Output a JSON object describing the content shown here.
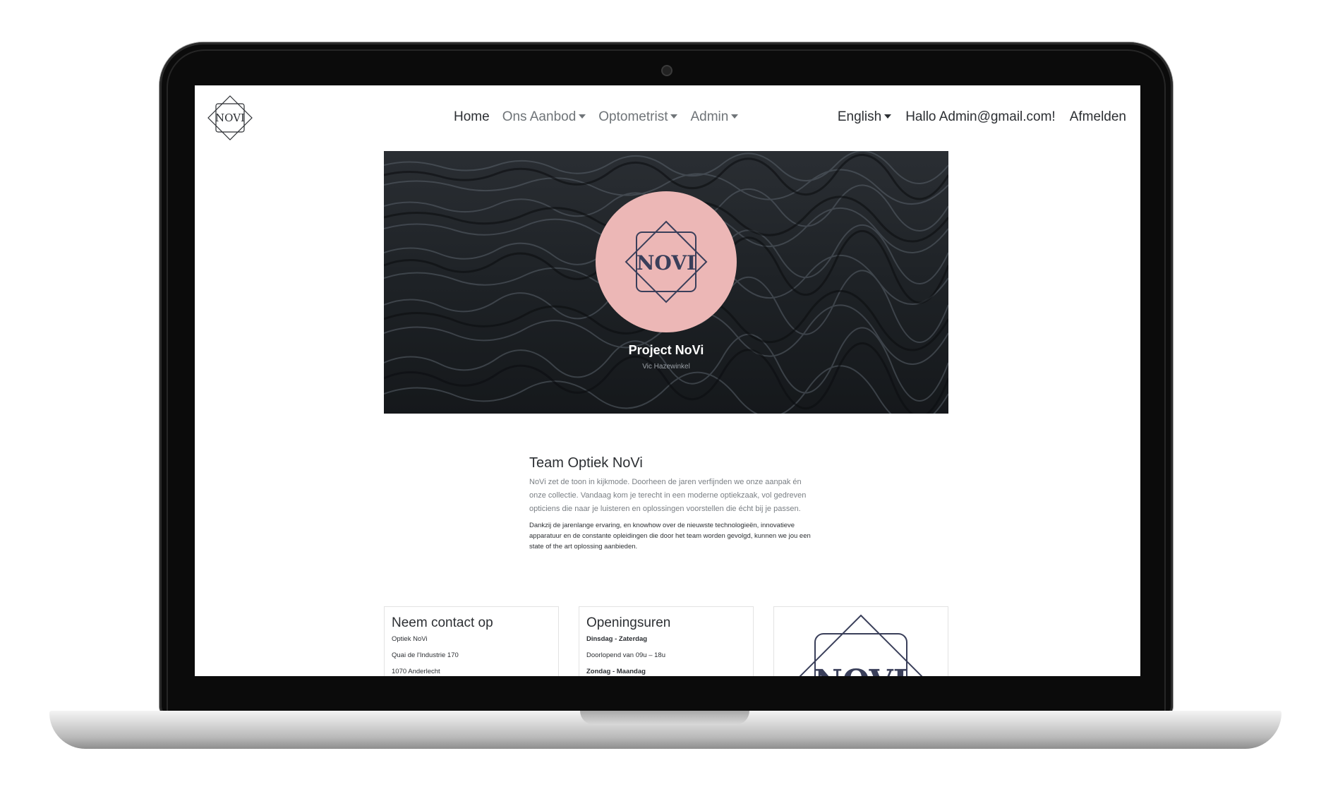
{
  "brand": {
    "logo_text": "NOVI"
  },
  "nav": {
    "home": "Home",
    "aanbod": "Ons Aanbod",
    "optometrist": "Optometrist",
    "admin": "Admin",
    "language": "English",
    "greeting": "Hallo Admin@gmail.com!",
    "logout": "Afmelden"
  },
  "hero": {
    "logo_text": "NOVI",
    "title": "Project NoVi",
    "subtitle": "Vic Hazewinkel",
    "circle_color": "#ecb7b6"
  },
  "about": {
    "title": "Team Optiek NoVi",
    "paragraph1": "NoVi zet de toon in kijkmode. Doorheen de jaren verfijnden we onze aanpak én onze collectie. Vandaag kom je terecht in een moderne optiekzaak, vol gedreven opticiens die naar je luisteren en oplossingen voorstellen die écht bij je passen.",
    "paragraph2": "Dankzij de jarenlange ervaring, en knowhow over de nieuwste technologieën, innovatieve apparatuur en de constante opleidingen die door het team worden gevolgd, kunnen we jou een state of the art oplossing aanbieden."
  },
  "contact": {
    "title": "Neem contact op",
    "name": "Optiek NoVi",
    "street": "Quai de l'Industrie 170",
    "city": "1070 Anderlecht"
  },
  "hours": {
    "title": "Openingsuren",
    "days1": "Dinsdag - Zaterdag",
    "time1": "Doorlopend van 09u – 18u",
    "days2": "Zondag - Maandag"
  },
  "card_logo": {
    "text": "NOVI"
  }
}
